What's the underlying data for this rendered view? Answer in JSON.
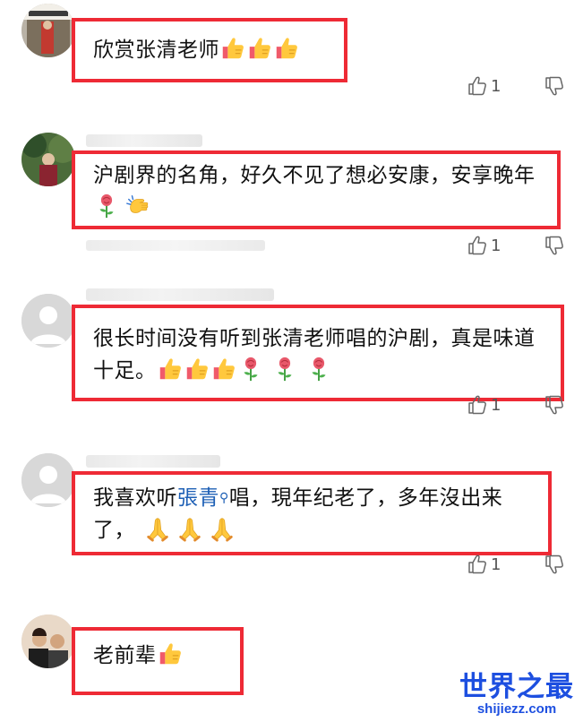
{
  "comments": [
    {
      "text": "欣赏张清老师",
      "emojis": [
        "thumbs-up",
        "thumbs-up",
        "thumbs-up"
      ],
      "likes": "1"
    },
    {
      "text": "沪剧界的名角，好久不见了想必安康，安享晚年",
      "emojis": [
        "rose",
        "clapping-hands"
      ],
      "likes": "1"
    },
    {
      "text": "很长时间没有听到张清老师唱的沪剧，真是味道十足。",
      "emojis": [
        "thumbs-up",
        "thumbs-up",
        "thumbs-up",
        "rose",
        "rose",
        "rose"
      ],
      "likes": "1"
    },
    {
      "text_before": "我喜欢听",
      "mention": "張青",
      "text_after": "唱，現年纪老了，多年沒出来了，",
      "emojis": [
        "folded-hands",
        "folded-hands",
        "folded-hands"
      ],
      "likes": "1"
    },
    {
      "text": "老前辈",
      "emojis": [
        "thumbs-up"
      ]
    }
  ],
  "watermark": {
    "title": "世界之最",
    "url": "shijiezz.com"
  },
  "colors": {
    "highlight_border": "#ee2a35",
    "mention": "#1d5fb5",
    "watermark": "#1d4fe0"
  }
}
